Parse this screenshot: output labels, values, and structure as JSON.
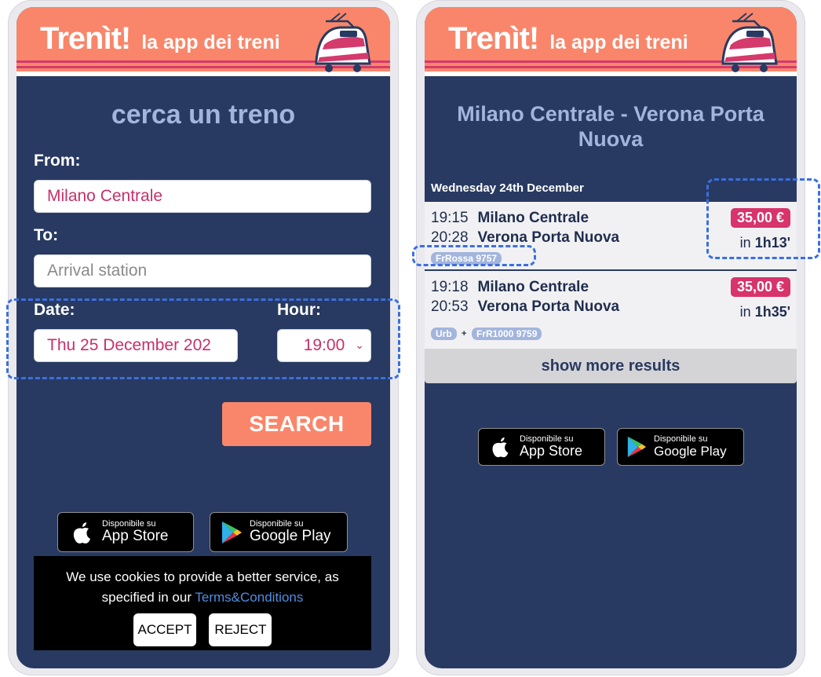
{
  "brand": {
    "name": "Trenìt!",
    "tagline": "la app dei treni"
  },
  "search": {
    "title": "cerca un treno",
    "from_label": "From:",
    "from_value": "Milano Centrale",
    "to_label": "To:",
    "to_placeholder": "Arrival station",
    "date_label": "Date:",
    "date_value": "Thu 25 December 202",
    "hour_label": "Hour:",
    "hour_value": "19:00",
    "search_button": "SEARCH"
  },
  "stores": {
    "available_on": "Disponibile su",
    "app_store": "App Store",
    "google_play": "Google Play"
  },
  "cookie": {
    "message": "We use cookies to provide a better service, as specified in our",
    "link": "Terms&Conditions",
    "accept": "ACCEPT",
    "reject": "REJECT"
  },
  "results": {
    "route_title": "Milano Centrale - Verona Porta Nuova",
    "date": "Wednesday 24th December",
    "items": [
      {
        "dep_time": "19:15",
        "dep_station": "Milano Centrale",
        "arr_time": "20:28",
        "arr_station": "Verona Porta Nuova",
        "price": "35,00 €",
        "duration_prefix": "in",
        "duration": "1h13'",
        "tags": [
          "FrRossa 9757"
        ]
      },
      {
        "dep_time": "19:18",
        "dep_station": "Milano Centrale",
        "arr_time": "20:53",
        "arr_station": "Verona Porta Nuova",
        "price": "35,00 €",
        "duration_prefix": "in",
        "duration": "1h35'",
        "tags": [
          "Urb",
          "FrR1000 9759"
        ]
      }
    ],
    "show_more": "show more results"
  },
  "colors": {
    "background": "#283a61",
    "header": "#f9866a",
    "accent": "#d8336a",
    "title": "#a3b5dd",
    "highlight": "#3a6fe0"
  },
  "icons": [
    "train-icon",
    "apple-icon",
    "google-play-icon",
    "chevron-down-icon"
  ]
}
